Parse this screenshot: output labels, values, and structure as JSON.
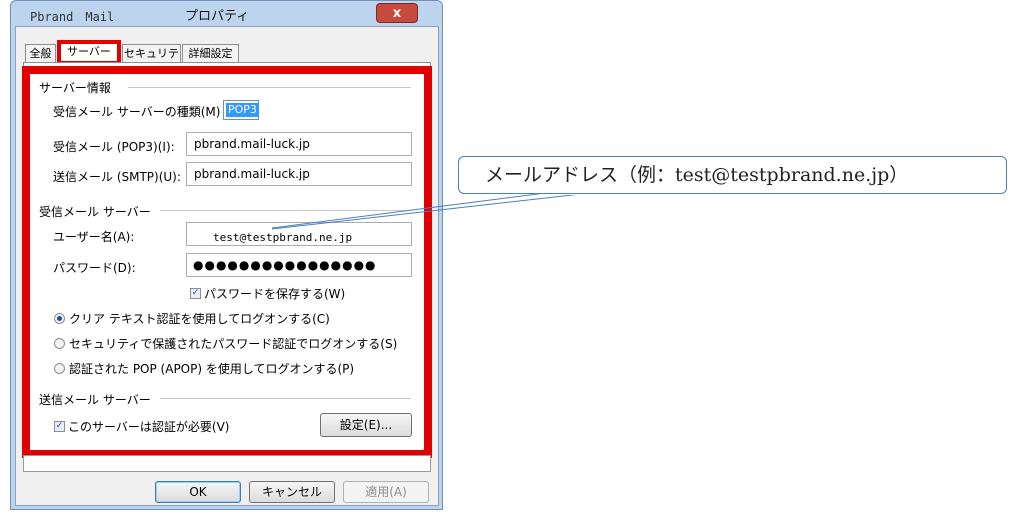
{
  "window": {
    "app_name": "Pbrand　Mail",
    "title": "プロパティ",
    "close_symbol": "x"
  },
  "tabs": [
    {
      "label": "全般"
    },
    {
      "label": "サーバー",
      "active": true
    },
    {
      "label": "セキュリティ"
    },
    {
      "label": "詳細設定"
    }
  ],
  "server_info": {
    "heading": "サーバー情報",
    "type_label": "受信メール サーバーの種類(M)",
    "type_value": "POP3",
    "incoming_label": "受信メール (POP3)(I):",
    "incoming_value": "pbrand.mail-luck.jp",
    "outgoing_label": "送信メール (SMTP)(U):",
    "outgoing_value": "pbrand.mail-luck.jp"
  },
  "incoming_server": {
    "heading": "受信メール サーバー",
    "username_label": "ユーザー名(A):",
    "username_value": "test@testpbrand.ne.jp",
    "password_label": "パスワード(D):",
    "password_value": "●●●●●●●●●●●●●●●●",
    "save_password_label": "パスワードを保存する(W)",
    "save_password_checked": true,
    "auth_options": [
      {
        "label": "クリア テキスト認証を使用してログオンする(C)",
        "selected": true
      },
      {
        "label": "セキュリティで保護されたパスワード認証でログオンする(S)",
        "selected": false
      },
      {
        "label": "認証された POP (APOP) を使用してログオンする(P)",
        "selected": false
      }
    ]
  },
  "outgoing_server": {
    "heading": "送信メール サーバー",
    "auth_required_label": "このサーバーは認証が必要(V)",
    "auth_required_checked": true,
    "settings_button": "設定(E)..."
  },
  "buttons": {
    "ok": "OK",
    "cancel": "キャンセル",
    "apply": "適用(A)"
  },
  "callout": {
    "text": "メールアドレス（例：test@testpbrand.ne.jp）"
  },
  "colors": {
    "highlight_red": "#e00000",
    "callout_blue": "#4a7fc1",
    "selection_blue": "#3399ff"
  }
}
